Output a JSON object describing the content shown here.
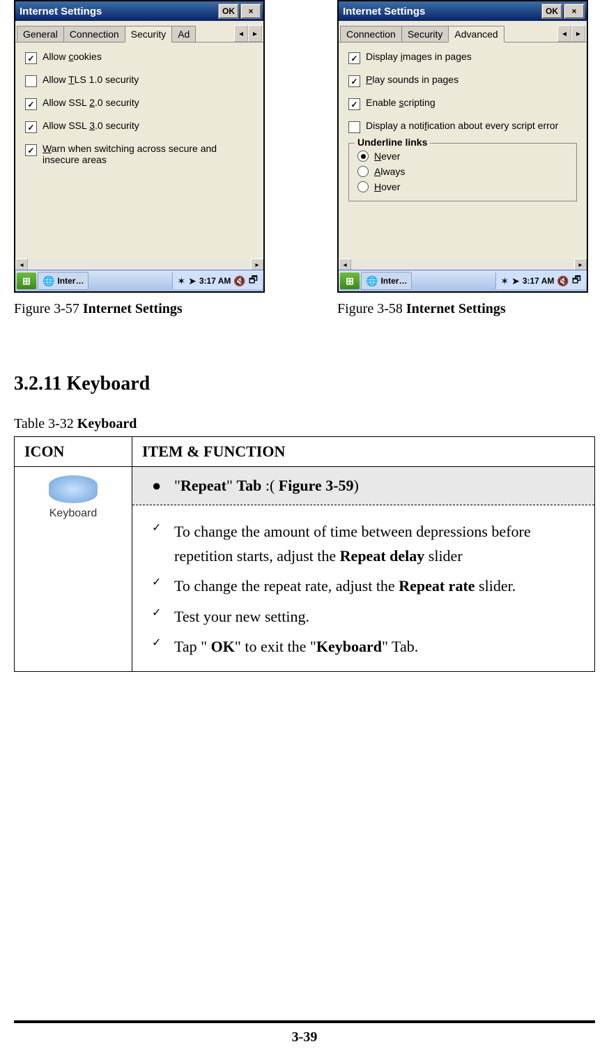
{
  "screenshots": {
    "left": {
      "window_title": "Internet Settings",
      "ok_label": "OK",
      "close_label": "×",
      "tabs": [
        "General",
        "Connection",
        "Security",
        "Ad"
      ],
      "tab_scroll_left": "◂",
      "tab_scroll_right": "▸",
      "options": [
        {
          "label": "Allow cookies",
          "checked": true,
          "underline_char": "c"
        },
        {
          "label": "Allow TLS 1.0 security",
          "checked": false,
          "underline_char": "T"
        },
        {
          "label": "Allow SSL 2.0 security",
          "checked": true,
          "underline_char": "2"
        },
        {
          "label": "Allow SSL 3.0 security",
          "checked": true,
          "underline_char": "3"
        },
        {
          "label": "Warn when switching across secure and insecure areas",
          "checked": true,
          "underline_char": "W"
        }
      ],
      "taskbar": {
        "task_label": "Inter…",
        "clock": "3:17 AM"
      },
      "caption_prefix": "Figure 3-57 ",
      "caption_bold": "Internet Settings"
    },
    "right": {
      "window_title": "Internet Settings",
      "ok_label": "OK",
      "close_label": "×",
      "tabs": [
        "Connection",
        "Security",
        "Advanced"
      ],
      "tab_scroll_left": "◂",
      "tab_scroll_right": "▸",
      "options": [
        {
          "label": "Display images in pages",
          "checked": true,
          "underline_char": "i"
        },
        {
          "label": "Play sounds in pages",
          "checked": true,
          "underline_char": "P"
        },
        {
          "label": "Enable scripting",
          "checked": true,
          "underline_char": "s"
        },
        {
          "label": "Display a notification about every script error",
          "checked": false,
          "underline_char": "f"
        }
      ],
      "group_title": "Underline links",
      "radios": [
        {
          "label": "Never",
          "selected": true,
          "underline_char": "N"
        },
        {
          "label": "Always",
          "selected": false,
          "underline_char": "A"
        },
        {
          "label": "Hover",
          "selected": false,
          "underline_char": "H"
        }
      ],
      "taskbar": {
        "task_label": "Inter…",
        "clock": "3:17 AM"
      },
      "caption_prefix": "Figure 3-58 ",
      "caption_bold": "Internet Settings"
    }
  },
  "section_heading": "3.2.11 Keyboard",
  "table_caption_prefix": "Table 3-32 ",
  "table_caption_bold": "Keyboard",
  "table": {
    "head_icon": "ICON",
    "head_func": "ITEM & FUNCTION",
    "icon_label": "Keyboard",
    "tab_line_full": "“Repeat” Tab :( Figure 3-59)",
    "items": [
      "To change the amount of time between depressions before repetition starts, adjust the Repeat delay slider",
      "To change the repeat rate, adjust the Repeat rate slider.",
      "Test your new setting.",
      "Tap “ OK” to exit the “Keyboard” Tab."
    ]
  },
  "page_number": "3-39"
}
